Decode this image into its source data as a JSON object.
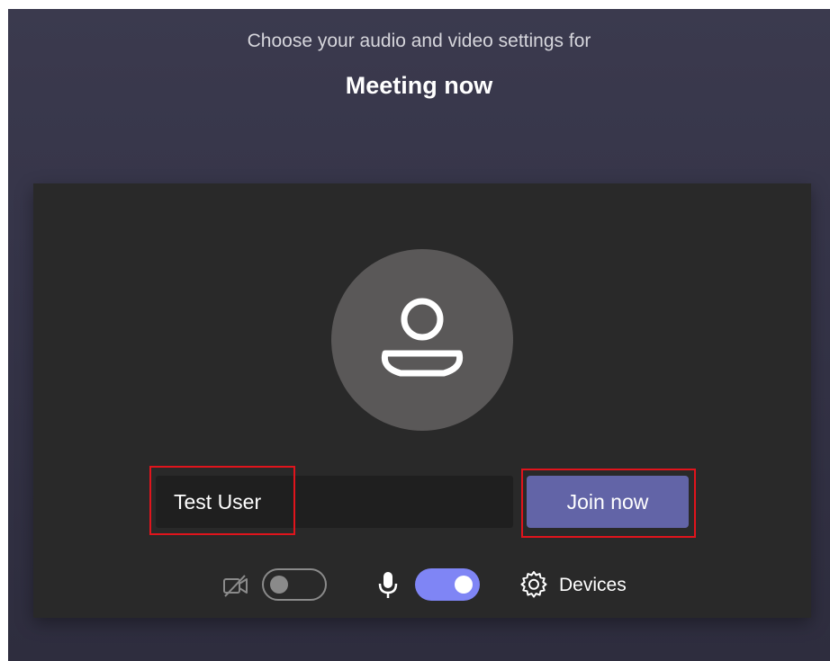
{
  "header": {
    "subtitle": "Choose your audio and video settings for",
    "meeting_title": "Meeting now"
  },
  "prejoin": {
    "name_value": "Test User",
    "join_label": "Join now",
    "devices_label": "Devices",
    "camera_on": false,
    "mic_on": true
  },
  "icons": {
    "avatar": "person-icon",
    "camera": "camera-off-icon",
    "mic": "microphone-icon",
    "devices": "gear-icon"
  },
  "colors": {
    "accent": "#6264a7",
    "toggle_on": "#7f85f5",
    "highlight": "#e0141c",
    "card_bg": "#292929",
    "page_bg": "#3b3a4e"
  }
}
